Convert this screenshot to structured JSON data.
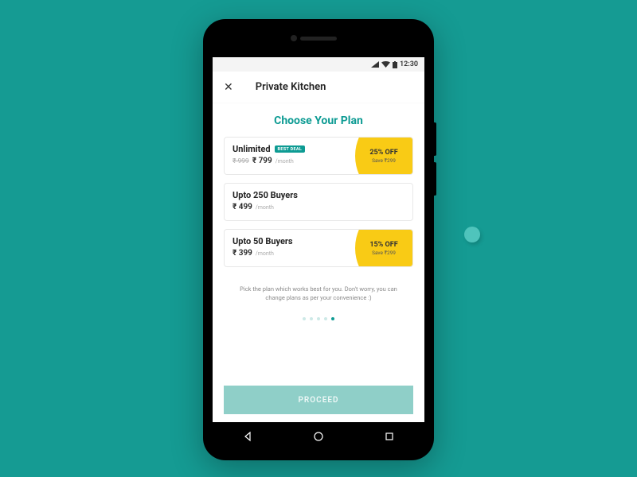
{
  "status": {
    "time": "12:30"
  },
  "header": {
    "title": "Private Kitchen"
  },
  "page": {
    "title": "Choose Your Plan",
    "helper": "Pick the plan which works best for you. Don't worry, you can change plans as per your convenience :)",
    "proceed": "PROCEED"
  },
  "plans": [
    {
      "name": "Unlimited",
      "badge": "BEST DEAL",
      "old_price": "₹ 999",
      "price": "₹ 799",
      "period": "/month",
      "offer_pct": "25% OFF",
      "offer_save": "Save ₹299"
    },
    {
      "name": "Upto 250 Buyers",
      "price": "₹ 499",
      "period": "/month"
    },
    {
      "name": "Upto 50 Buyers",
      "price": "₹ 399",
      "period": "/month",
      "offer_pct": "15% OFF",
      "offer_save": "Save ₹299"
    }
  ]
}
